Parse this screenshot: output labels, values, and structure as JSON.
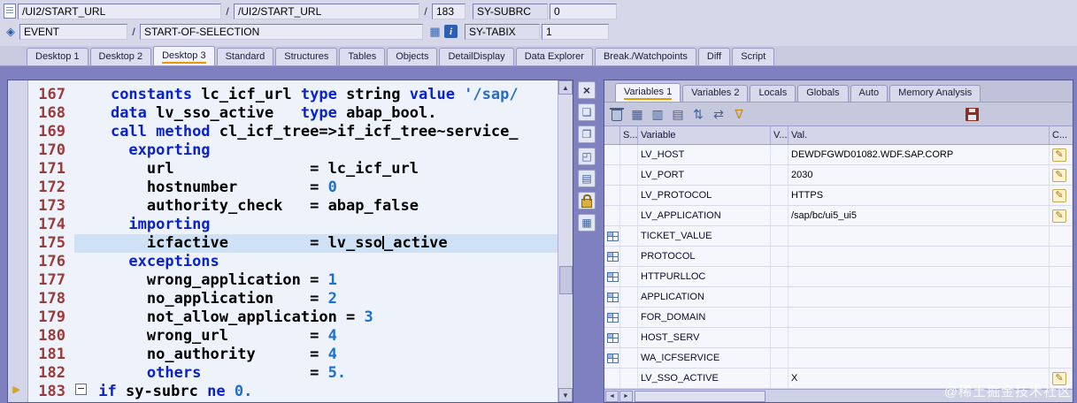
{
  "topbar": {
    "separator": "/",
    "program_field": "/UI2/START_URL",
    "include_field": "/UI2/START_URL",
    "line_number": "183",
    "subrc_label": "SY-SUBRC",
    "subrc_value": "0",
    "event_field": "EVENT",
    "event_value": "START-OF-SELECTION",
    "tabix_label": "SY-TABIX",
    "tabix_value": "1"
  },
  "desktop_tabs": [
    {
      "label": "Desktop 1",
      "active": false
    },
    {
      "label": "Desktop 2",
      "active": false
    },
    {
      "label": "Desktop 3",
      "active": true
    },
    {
      "label": "Standard",
      "active": false
    },
    {
      "label": "Structures",
      "active": false
    },
    {
      "label": "Tables",
      "active": false
    },
    {
      "label": "Objects",
      "active": false
    },
    {
      "label": "DetailDisplay",
      "active": false
    },
    {
      "label": "Data Explorer",
      "active": false
    },
    {
      "label": "Break./Watchpoints",
      "active": false
    },
    {
      "label": "Diff",
      "active": false
    },
    {
      "label": "Script",
      "active": false
    }
  ],
  "editor": {
    "lines": [
      {
        "num": "167",
        "segments": [
          {
            "c": "pl",
            "t": "    "
          },
          {
            "c": "kw",
            "t": "constants"
          },
          {
            "c": "pl",
            "t": " lc_icf_url "
          },
          {
            "c": "kw",
            "t": "type"
          },
          {
            "c": "pl",
            "t": " string "
          },
          {
            "c": "kw",
            "t": "value"
          },
          {
            "c": "str",
            "t": " '/sap/"
          }
        ]
      },
      {
        "num": "168",
        "segments": [
          {
            "c": "pl",
            "t": "    "
          },
          {
            "c": "kw",
            "t": "data"
          },
          {
            "c": "pl",
            "t": " lv_sso_active   "
          },
          {
            "c": "kw",
            "t": "type"
          },
          {
            "c": "pl",
            "t": " abap_bool."
          }
        ]
      },
      {
        "num": "169",
        "segments": [
          {
            "c": "pl",
            "t": "    "
          },
          {
            "c": "kw",
            "t": "call method"
          },
          {
            "c": "pl",
            "t": " cl_icf_tree=>if_icf_tree~service_"
          }
        ]
      },
      {
        "num": "170",
        "segments": [
          {
            "c": "pl",
            "t": "      "
          },
          {
            "c": "kw",
            "t": "exporting"
          }
        ]
      },
      {
        "num": "171",
        "segments": [
          {
            "c": "pl",
            "t": "        url               = lc_icf_url"
          }
        ]
      },
      {
        "num": "172",
        "segments": [
          {
            "c": "pl",
            "t": "        hostnumber        = "
          },
          {
            "c": "num",
            "t": "0"
          }
        ]
      },
      {
        "num": "173",
        "segments": [
          {
            "c": "pl",
            "t": "        authority_check   = abap_false"
          }
        ]
      },
      {
        "num": "174",
        "segments": [
          {
            "c": "pl",
            "t": "      "
          },
          {
            "c": "kw",
            "t": "importing"
          }
        ]
      },
      {
        "num": "175",
        "highlight": true,
        "segments": [
          {
            "c": "pl",
            "t": "        icfactive         = lv_sso"
          },
          {
            "c": "caret"
          },
          {
            "c": "pl",
            "t": "_active"
          }
        ]
      },
      {
        "num": "176",
        "segments": [
          {
            "c": "pl",
            "t": "      "
          },
          {
            "c": "kw",
            "t": "exceptions"
          }
        ]
      },
      {
        "num": "177",
        "segments": [
          {
            "c": "pl",
            "t": "        wrong_application = "
          },
          {
            "c": "num",
            "t": "1"
          }
        ]
      },
      {
        "num": "178",
        "segments": [
          {
            "c": "pl",
            "t": "        no_application    = "
          },
          {
            "c": "num",
            "t": "2"
          }
        ]
      },
      {
        "num": "179",
        "segments": [
          {
            "c": "pl",
            "t": "        not_allow_application = "
          },
          {
            "c": "num",
            "t": "3"
          }
        ]
      },
      {
        "num": "180",
        "segments": [
          {
            "c": "pl",
            "t": "        wrong_url         = "
          },
          {
            "c": "num",
            "t": "4"
          }
        ]
      },
      {
        "num": "181",
        "segments": [
          {
            "c": "pl",
            "t": "        no_authority      = "
          },
          {
            "c": "num",
            "t": "4"
          }
        ]
      },
      {
        "num": "182",
        "segments": [
          {
            "c": "pl",
            "t": "        "
          },
          {
            "c": "kw",
            "t": "others"
          },
          {
            "c": "pl",
            "t": "            = "
          },
          {
            "c": "num",
            "t": "5."
          }
        ]
      },
      {
        "num": "183",
        "marker": true,
        "segments": [
          {
            "c": "fold"
          },
          {
            "c": "pl",
            "t": " "
          },
          {
            "c": "kw",
            "t": "if"
          },
          {
            "c": "pl",
            "t": " sy-subrc "
          },
          {
            "c": "kw",
            "t": "ne"
          },
          {
            "c": "pl",
            "t": " "
          },
          {
            "c": "num",
            "t": "0."
          }
        ]
      }
    ]
  },
  "editor_tools": [
    {
      "name": "close-icon",
      "glyph": "×",
      "cls": "dark"
    },
    {
      "name": "new-session-icon",
      "glyph": "❏"
    },
    {
      "name": "copy-icon",
      "glyph": "❐"
    },
    {
      "name": "maximize-icon",
      "glyph": "◰"
    },
    {
      "name": "list-icon",
      "glyph": "▤"
    },
    {
      "name": "unlock-icon",
      "shape": "lock"
    },
    {
      "name": "edit-table-icon",
      "glyph": "▦"
    }
  ],
  "variables_panel": {
    "tabs": [
      {
        "label": "Variables 1",
        "active": true
      },
      {
        "label": "Variables 2",
        "active": false
      },
      {
        "label": "Locals",
        "active": false
      },
      {
        "label": "Globals",
        "active": false
      },
      {
        "label": "Auto",
        "active": false
      },
      {
        "label": "Memory Analysis",
        "active": false
      }
    ],
    "toolbar": [
      {
        "name": "delete-icon",
        "shape": "trash"
      },
      {
        "name": "change-layout-icon",
        "glyph": "▦"
      },
      {
        "name": "insert-row-icon",
        "glyph": "▥"
      },
      {
        "name": "table-view-icon",
        "glyph": "▤"
      },
      {
        "name": "sort-icon",
        "glyph": "⇅"
      },
      {
        "name": "swap-icon",
        "glyph": "⇄"
      },
      {
        "name": "filter-icon",
        "glyph": "∇",
        "cls": "amber"
      }
    ],
    "table": {
      "headers": [
        "",
        "S...",
        "Variable",
        "V...",
        "Val.",
        "C..."
      ],
      "rows": [
        {
          "variable": "LV_HOST",
          "val": "DEWDFGWD01082.WDF.SAP.CORP",
          "struct": false,
          "editable": true
        },
        {
          "variable": "LV_PORT",
          "val": "2030",
          "struct": false,
          "editable": true
        },
        {
          "variable": "LV_PROTOCOL",
          "val": "HTTPS",
          "struct": false,
          "editable": true
        },
        {
          "variable": "LV_APPLICATION",
          "val": "/sap/bc/ui5_ui5",
          "struct": false,
          "editable": true
        },
        {
          "variable": "TICKET_VALUE",
          "val": "",
          "struct": true,
          "editable": false
        },
        {
          "variable": "PROTOCOL",
          "val": "",
          "struct": true,
          "editable": false
        },
        {
          "variable": "HTTPURLLOC",
          "val": "",
          "struct": true,
          "editable": false
        },
        {
          "variable": "APPLICATION",
          "val": "",
          "struct": true,
          "editable": false
        },
        {
          "variable": "FOR_DOMAIN",
          "val": "",
          "struct": true,
          "editable": false
        },
        {
          "variable": "HOST_SERV",
          "val": "",
          "struct": true,
          "editable": false
        },
        {
          "variable": "WA_ICFSERVICE",
          "val": "",
          "struct": true,
          "editable": false
        },
        {
          "variable": "LV_SSO_ACTIVE",
          "val": "X",
          "struct": false,
          "editable": true
        }
      ]
    }
  },
  "watermark": "@稀土掘金技术社区"
}
